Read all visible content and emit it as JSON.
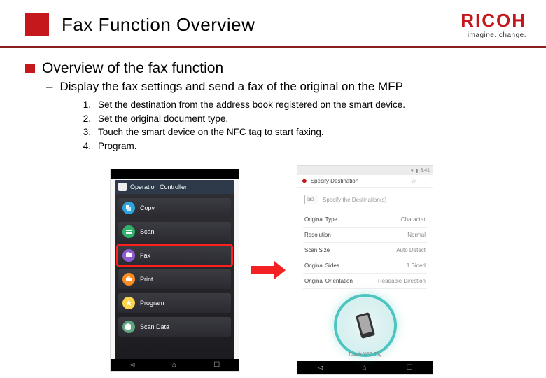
{
  "brand": {
    "name": "RICOH",
    "tagline": "imagine. change."
  },
  "slide": {
    "title": "Fax Function Overview",
    "section": "Overview of the fax function",
    "sub": "Display the fax settings and send a fax of the original on the MFP",
    "steps": [
      "Set the destination from the address book registered on the smart device.",
      "Set the original document type.",
      "Touch the smart device on the NFC tag to start faxing.",
      "Program."
    ]
  },
  "left_device": {
    "header": "Operation Controller",
    "items": [
      {
        "label": "Copy",
        "icon": "ic-copy"
      },
      {
        "label": "Scan",
        "icon": "ic-scan"
      },
      {
        "label": "Fax",
        "icon": "ic-fax",
        "highlight": true
      },
      {
        "label": "Print",
        "icon": "ic-print"
      },
      {
        "label": "Program",
        "icon": "ic-prog"
      },
      {
        "label": "Scan Data",
        "icon": "ic-data"
      }
    ]
  },
  "right_device": {
    "header": "Specify Destination",
    "dest_placeholder": "Specify the Destination(s)",
    "rows": [
      {
        "label": "Original Type",
        "value": "Character"
      },
      {
        "label": "Resolution",
        "value": "Normal"
      },
      {
        "label": "Scan Size",
        "value": "Auto Detect"
      },
      {
        "label": "Original Sides",
        "value": "1 Sided"
      },
      {
        "label": "Original Orientation",
        "value": "Readable Direction"
      }
    ],
    "nfc_caption": "Touch NFC Tag"
  },
  "accent": "#c4181d"
}
